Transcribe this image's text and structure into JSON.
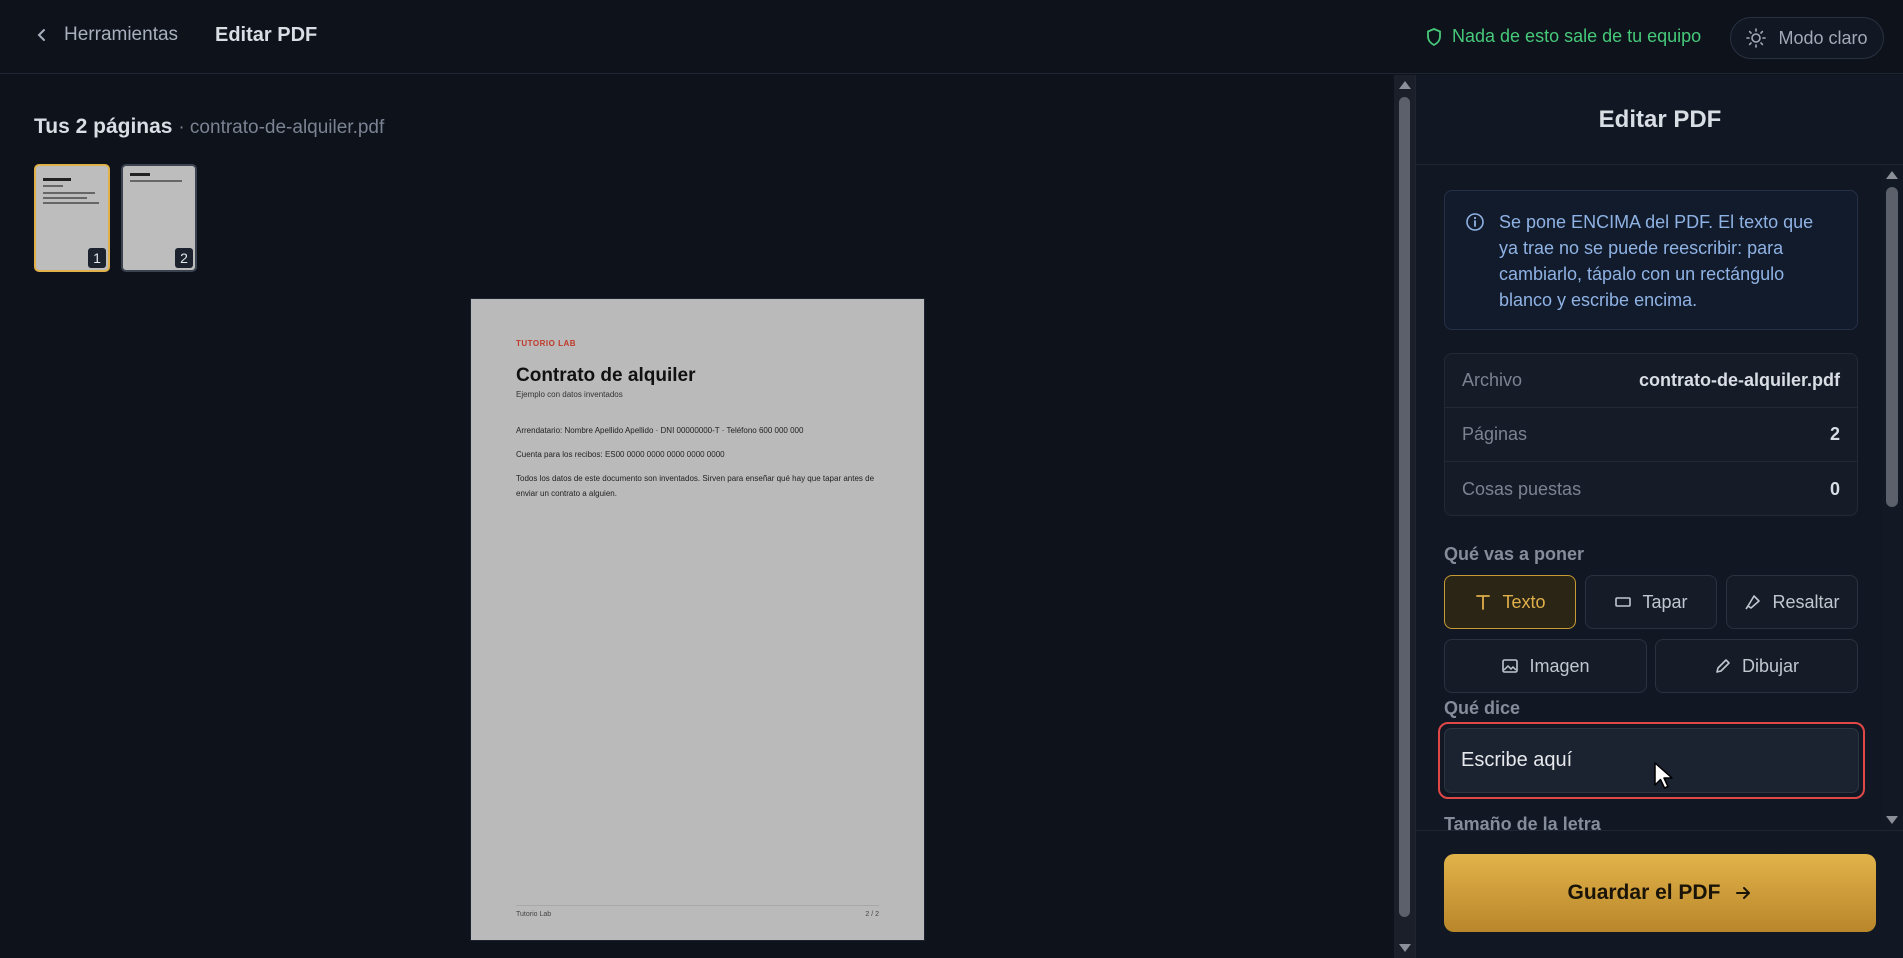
{
  "header": {
    "back_label": "Herramientas",
    "title": "Editar PDF",
    "privacy_text": "Nada de esto sale de tu equipo",
    "mode_label": "Modo claro"
  },
  "pages": {
    "heading_strong": "Tus 2 páginas",
    "heading_file": "· contrato-de-alquiler.pdf",
    "thumbs": [
      {
        "number": "1"
      },
      {
        "number": "2"
      }
    ]
  },
  "document": {
    "brand": "TUTORIO LAB",
    "title": "Contrato de alquiler",
    "subtitle": "Ejemplo con datos inventados",
    "line1": "Arrendatario: Nombre Apellido Apellido · DNI 00000000-T · Teléfono 600 000 000",
    "line2": "Cuenta para los recibos: ES00 0000 0000 0000 0000 0000",
    "line3": "Todos los datos de este documento son inventados. Sirven para enseñar qué hay que tapar antes de enviar un contrato a alguien.",
    "footer_left": "Tutorio Lab",
    "footer_right": "2 / 2"
  },
  "panel": {
    "title": "Editar PDF",
    "info": "Se pone ENCIMA del PDF. El texto que ya trae no se puede reescribir: para cambiarlo, tápalo con un rectángulo blanco y escribe encima.",
    "stats": [
      {
        "key": "Archivo",
        "value": "contrato-de-alquiler.pdf"
      },
      {
        "key": "Páginas",
        "value": "2"
      },
      {
        "key": "Cosas puestas",
        "value": "0"
      }
    ],
    "what_label": "Qué vas a poner",
    "tools": {
      "texto": "Texto",
      "tapar": "Tapar",
      "resaltar": "Resaltar",
      "imagen": "Imagen",
      "dibujar": "Dibujar"
    },
    "says_label": "Qué dice",
    "input_placeholder": "Escribe aquí",
    "font_size_label": "Tamaño de la letra",
    "save_label": "Guardar el PDF"
  },
  "colors": {
    "accent": "#e0b04a",
    "privacy_green": "#47c97a",
    "info_blue": "#8fb2e4",
    "focus_red": "#e04848"
  }
}
